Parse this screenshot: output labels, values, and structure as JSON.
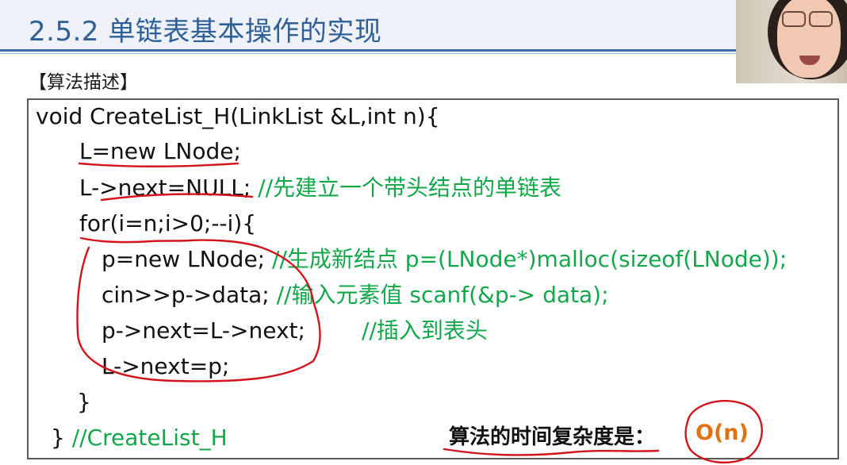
{
  "slide": {
    "title": "2.5.2 单链表基本操作的实现",
    "section_label": "【算法描述】"
  },
  "code": {
    "lines": [
      {
        "code": "void CreateList_H(LinkList &L,int n){",
        "comment": ""
      },
      {
        "code": "L=new LNode;",
        "comment": ""
      },
      {
        "code": "L->next=NULL; ",
        "comment": "//先建立一个带头结点的单链表"
      },
      {
        "code": "for(i=n;i>0;--i){",
        "comment": ""
      },
      {
        "code": "p=new LNode; ",
        "comment": "//生成新结点 p=(LNode*)malloc(sizeof(LNode));"
      },
      {
        "code": "cin>>p->data; ",
        "comment": "//输入元素值 scanf(&p-> data);"
      },
      {
        "code": "p->next=L->next;",
        "comment": "//插入到表头"
      },
      {
        "code": "L->next=p;",
        "comment": ""
      },
      {
        "code": "}",
        "comment": ""
      },
      {
        "code": "} ",
        "comment": "//CreateList_H"
      }
    ]
  },
  "complexity": {
    "label": "算法的时间复杂度是：",
    "value": "O(n)"
  },
  "colors": {
    "title": "#2f5f97",
    "comment": "#12a84a",
    "annotation": "#d2141c",
    "complexity_value": "#e07214"
  }
}
